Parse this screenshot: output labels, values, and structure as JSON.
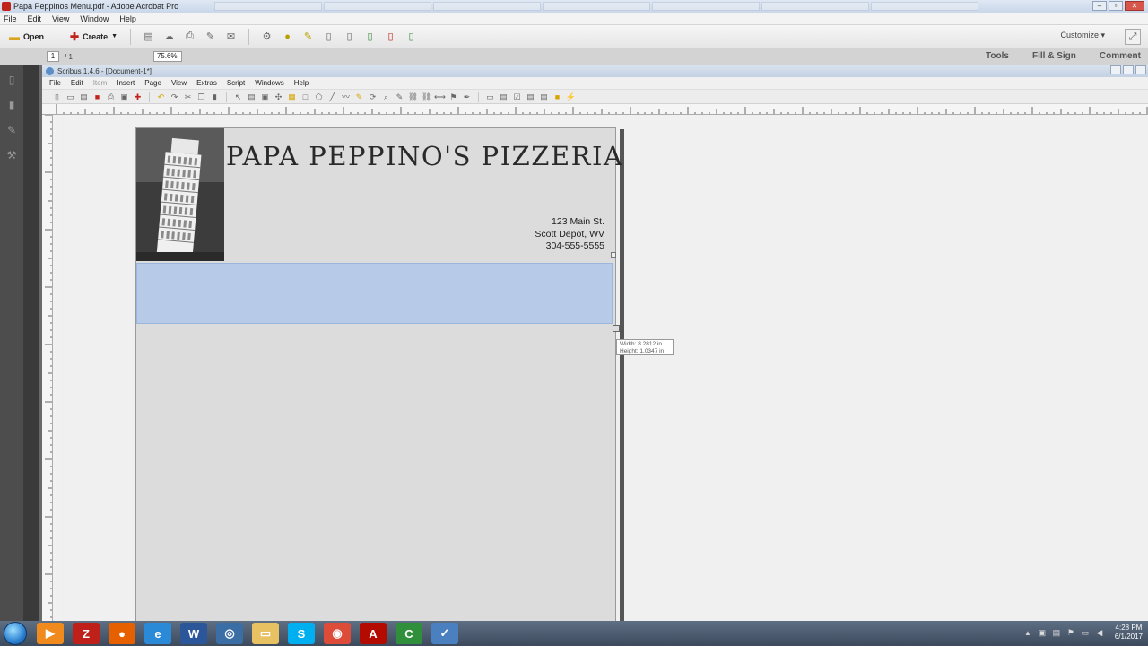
{
  "acrobat": {
    "title": "Papa Peppinos Menu.pdf - Adobe Acrobat Pro",
    "menu": [
      "File",
      "Edit",
      "View",
      "Window",
      "Help"
    ],
    "toolbar": {
      "open_label": "Open",
      "create_label": "Create",
      "customize_label": "Customize"
    },
    "nav": {
      "page_current": "1",
      "page_total": "/ 1",
      "zoom": "75.6%"
    },
    "right_tabs": [
      "Tools",
      "Fill & Sign",
      "Comment"
    ]
  },
  "scribus": {
    "title": "Scribus 1.4.6 - [Document-1*]",
    "menu": [
      "File",
      "Edit",
      "Item",
      "Insert",
      "Page",
      "View",
      "Extras",
      "Script",
      "Windows",
      "Help"
    ]
  },
  "document": {
    "title": "PAPA PEPPINO'S PIZZERIA",
    "address": {
      "line1": "123 Main St.",
      "line2": "Scott Depot, WV",
      "line3": "304-555-5555"
    }
  },
  "size_tooltip": {
    "width": "Width: 8.2812 in",
    "height": "Height: 1.0347 in"
  },
  "taskbar": {
    "apps": [
      {
        "name": "media-player-icon",
        "glyph": "▶",
        "color": "#f08a1c"
      },
      {
        "name": "filezilla-icon",
        "glyph": "Z",
        "color": "#c0201a"
      },
      {
        "name": "firefox-icon",
        "glyph": "●",
        "color": "#e66000"
      },
      {
        "name": "internet-explorer-icon",
        "glyph": "e",
        "color": "#2b8ad8"
      },
      {
        "name": "word-icon",
        "glyph": "W",
        "color": "#2b579a"
      },
      {
        "name": "scribus-icon",
        "glyph": "◎",
        "color": "#3a6ea5"
      },
      {
        "name": "file-explorer-icon",
        "glyph": "▭",
        "color": "#e8c262"
      },
      {
        "name": "skype-icon",
        "glyph": "S",
        "color": "#00aff0"
      },
      {
        "name": "chrome-icon",
        "glyph": "◉",
        "color": "#dd4b39"
      },
      {
        "name": "acrobat-icon",
        "glyph": "A",
        "color": "#b30b00"
      },
      {
        "name": "camtasia-icon",
        "glyph": "C",
        "color": "#2f8f3a"
      },
      {
        "name": "app-icon",
        "glyph": "✓",
        "color": "#4a7fc0"
      }
    ],
    "time": "4:28 PM",
    "date": "6/1/2017"
  }
}
